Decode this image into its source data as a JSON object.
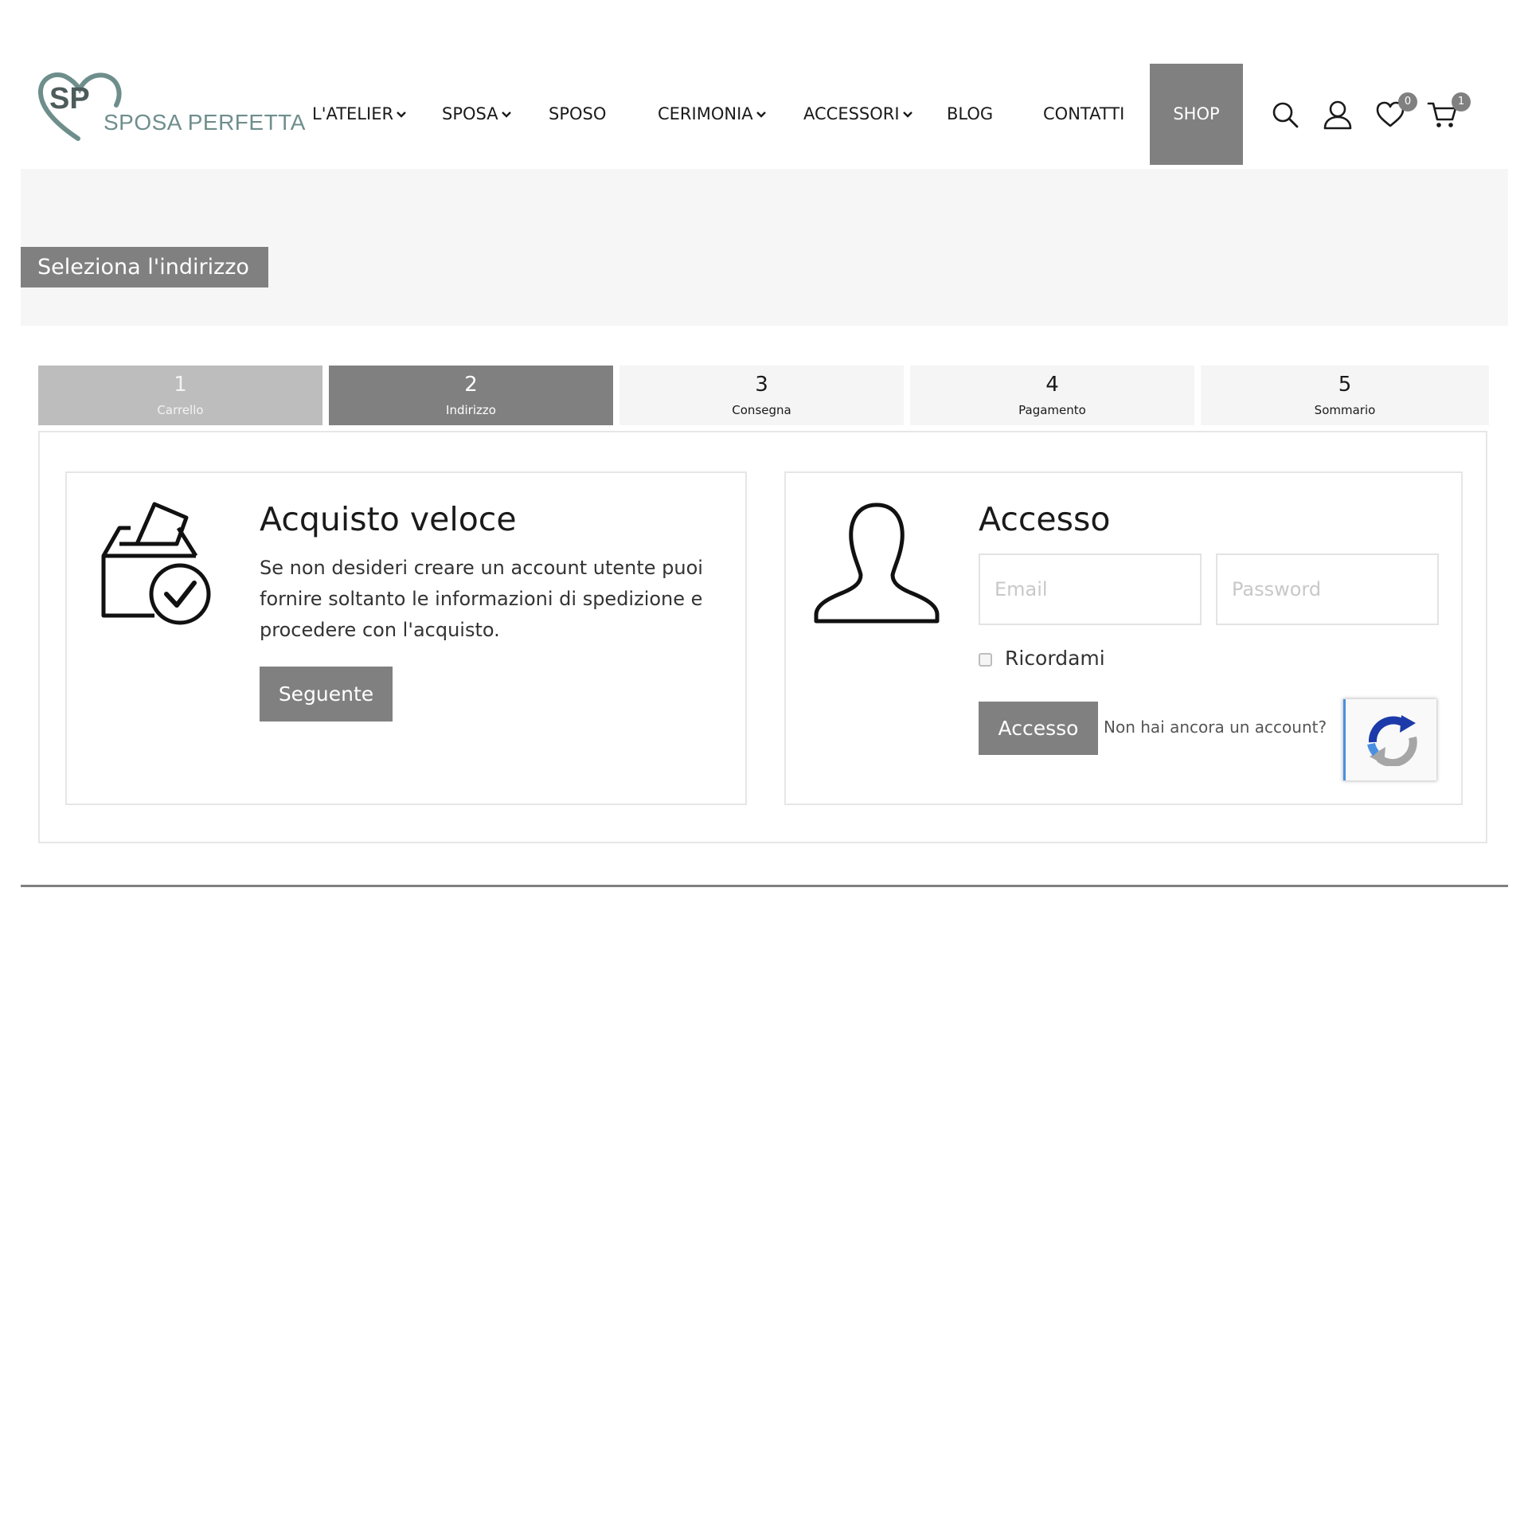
{
  "brand": {
    "logo_monogram": "SP",
    "logo_text": "SPOSA PERFETTA"
  },
  "nav": {
    "items": [
      {
        "label": "L'ATELIER",
        "has_dropdown": true
      },
      {
        "label": "SPOSA",
        "has_dropdown": true
      },
      {
        "label": "SPOSO",
        "has_dropdown": false
      },
      {
        "label": "CERIMONIA",
        "has_dropdown": true
      },
      {
        "label": "ACCESSORI",
        "has_dropdown": true
      },
      {
        "label": "BLOG",
        "has_dropdown": false
      },
      {
        "label": "CONTATTI",
        "has_dropdown": false
      },
      {
        "label": "SHOP",
        "has_dropdown": false,
        "active": true
      }
    ],
    "icons": [
      "search-icon",
      "user-icon",
      "heart-icon",
      "cart-icon"
    ],
    "wishlist_count": "0",
    "cart_count": "1"
  },
  "page": {
    "title": "Seleziona l'indirizzo"
  },
  "steps": [
    {
      "number": "1",
      "label": "Carrello",
      "state": "done"
    },
    {
      "number": "2",
      "label": "Indirizzo",
      "state": "active"
    },
    {
      "number": "3",
      "label": "Consegna",
      "state": "todo"
    },
    {
      "number": "4",
      "label": "Pagamento",
      "state": "todo"
    },
    {
      "number": "5",
      "label": "Sommario",
      "state": "todo"
    }
  ],
  "quick_buy": {
    "title": "Acquisto veloce",
    "description": "Se non desideri creare un account utente puoi fornire soltanto le informazioni di spedizione e procedere con l'acquisto.",
    "button": "Seguente",
    "icon": "ballot-box-check-icon"
  },
  "login": {
    "title": "Accesso",
    "email_placeholder": "Email",
    "email_value": "",
    "password_placeholder": "Password",
    "password_value": "",
    "remember_label": "Ricordami",
    "remember_checked": false,
    "submit_button": "Accesso",
    "signup_link": "Non hai ancora un account?",
    "icon": "person-silhouette-icon",
    "captcha_icon": "recaptcha-icon"
  },
  "colors": {
    "accent_gray": "#808080",
    "logo_teal": "#6e8e8c",
    "recaptcha_blue": "#4a90e2"
  }
}
